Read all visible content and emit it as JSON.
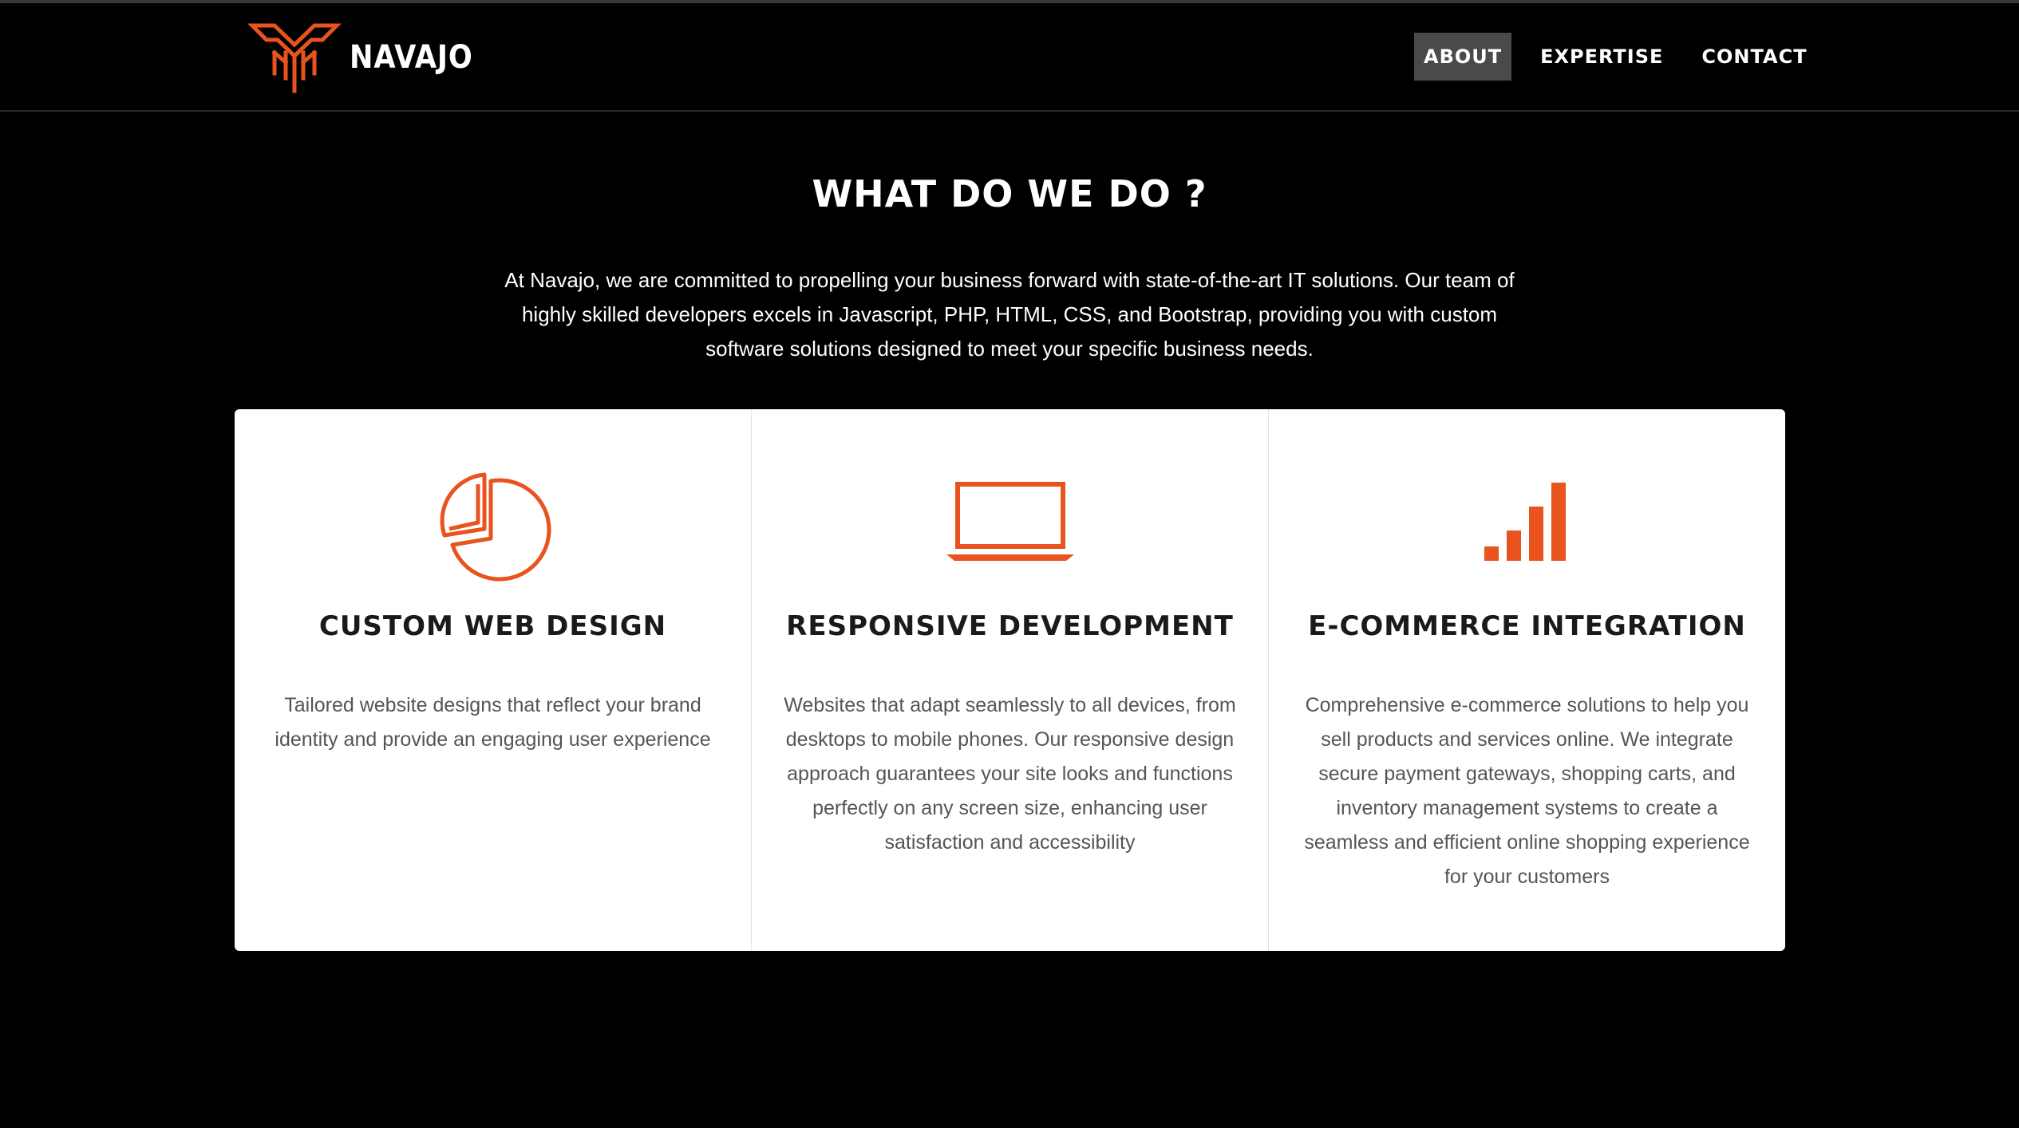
{
  "brand": {
    "name": "NAVAJO",
    "logo_icon": "navajo-logo-icon"
  },
  "nav": {
    "items": [
      {
        "label": "ABOUT",
        "active": true
      },
      {
        "label": "EXPERTISE",
        "active": false
      },
      {
        "label": "CONTACT",
        "active": false
      }
    ]
  },
  "section": {
    "title": "WHAT DO WE DO ?",
    "intro_lines": [
      "At Navajo, we are committed to propelling your business forward with state-of-the-art IT solutions. Our team of",
      "highly skilled developers excels in Javascript, PHP, HTML, CSS, and Bootstrap, providing you with custom",
      "software solutions designed to meet your specific business needs."
    ]
  },
  "cards": [
    {
      "icon": "pie-chart-icon",
      "title": "CUSTOM WEB DESIGN",
      "desc_lines": [
        "Tailored website designs that reflect your brand",
        "identity and provide an engaging user experience"
      ]
    },
    {
      "icon": "laptop-icon",
      "title": "RESPONSIVE DEVELOPMENT",
      "desc_lines": [
        "Websites that adapt seamlessly to all devices, from",
        "desktops to mobile phones. Our responsive design",
        "approach guarantees your site looks and functions",
        "perfectly on any screen size, enhancing user",
        "satisfaction and accessibility"
      ]
    },
    {
      "icon": "signal-bars-icon",
      "title": "E-COMMERCE INTEGRATION",
      "desc_lines": [
        "Comprehensive e-commerce solutions to help you",
        "sell products and services online. We integrate",
        "secure payment gateways, shopping carts, and",
        "inventory management systems to create a",
        "seamless and efficient online shopping experience",
        "for your customers"
      ]
    }
  ],
  "colors": {
    "accent": "#E8531E",
    "background": "#000000",
    "card_bg": "#FFFFFF",
    "nav_active_bg": "#4A4A4A"
  }
}
